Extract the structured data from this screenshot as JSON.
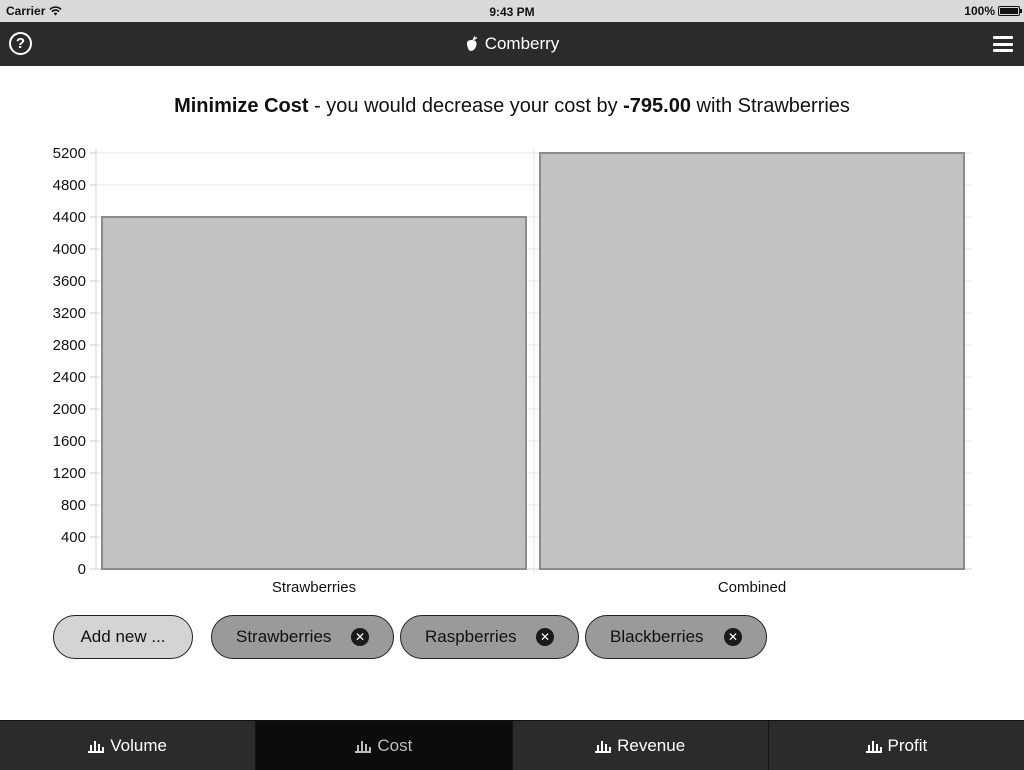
{
  "status_bar": {
    "carrier": "Carrier",
    "time": "9:43 PM",
    "battery": "100%"
  },
  "nav": {
    "title": "Comberry",
    "help_icon": "help-icon",
    "menu_icon": "menu-icon"
  },
  "headline": {
    "strong1": "Minimize Cost",
    "text1": " - you would decrease your cost by ",
    "strong2": "-795.00",
    "text2": " with Strawberries"
  },
  "chart_data": {
    "type": "bar",
    "categories": [
      "Strawberries",
      "Combined"
    ],
    "values": [
      4400,
      5200
    ],
    "ylim": [
      0,
      5200
    ],
    "yticks": [
      0,
      400,
      800,
      1200,
      1600,
      2000,
      2400,
      2800,
      3200,
      3600,
      4000,
      4400,
      4800,
      5200
    ],
    "grid": true,
    "bar_color": "#c2c2c2",
    "bar_border": "#8c8c8c"
  },
  "chips": {
    "add_label": "Add new ...",
    "items": [
      {
        "label": "Strawberries"
      },
      {
        "label": "Raspberries"
      },
      {
        "label": "Blackberries"
      }
    ]
  },
  "tabs": [
    {
      "label": "Volume",
      "active": false
    },
    {
      "label": "Cost",
      "active": true
    },
    {
      "label": "Revenue",
      "active": false
    },
    {
      "label": "Profit",
      "active": false
    }
  ]
}
